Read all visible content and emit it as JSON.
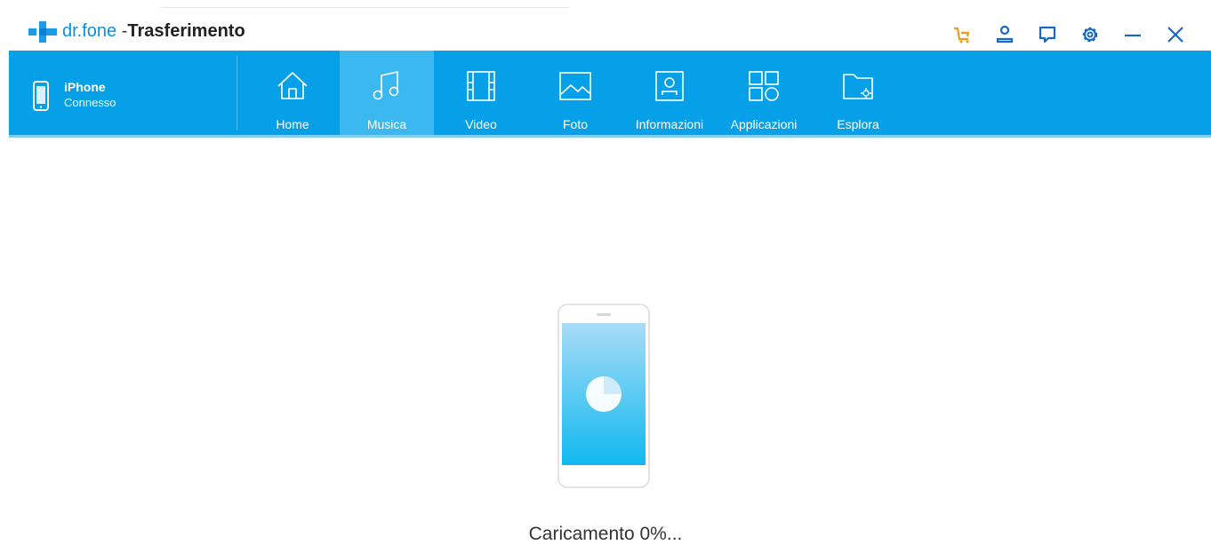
{
  "window": {
    "brand": "dr.fone",
    "separator": " -",
    "subtitle": "Trasferimento",
    "icons": [
      "cart-icon",
      "user-icon",
      "feedback-icon",
      "settings-icon",
      "minimize-icon",
      "close-icon"
    ]
  },
  "device": {
    "name": "iPhone",
    "status": "Connesso"
  },
  "nav": {
    "tabs": [
      {
        "label": "Home",
        "icon": "home-icon"
      },
      {
        "label": "Musica",
        "icon": "music-icon"
      },
      {
        "label": "Video",
        "icon": "video-icon"
      },
      {
        "label": "Foto",
        "icon": "photo-icon"
      },
      {
        "label": "Informazioni",
        "icon": "contacts-icon"
      },
      {
        "label": "Applicazioni",
        "icon": "apps-icon"
      },
      {
        "label": "Esplora",
        "icon": "explorer-icon"
      }
    ],
    "active": "Musica"
  },
  "loading": {
    "text": "Caricamento 0%...",
    "progress_percent": 0
  },
  "colors": {
    "accent": "#06a0e9",
    "active_tab": "#3bb8ef",
    "cart": "#f39c12",
    "brand_blue": "#0a8fe0"
  }
}
